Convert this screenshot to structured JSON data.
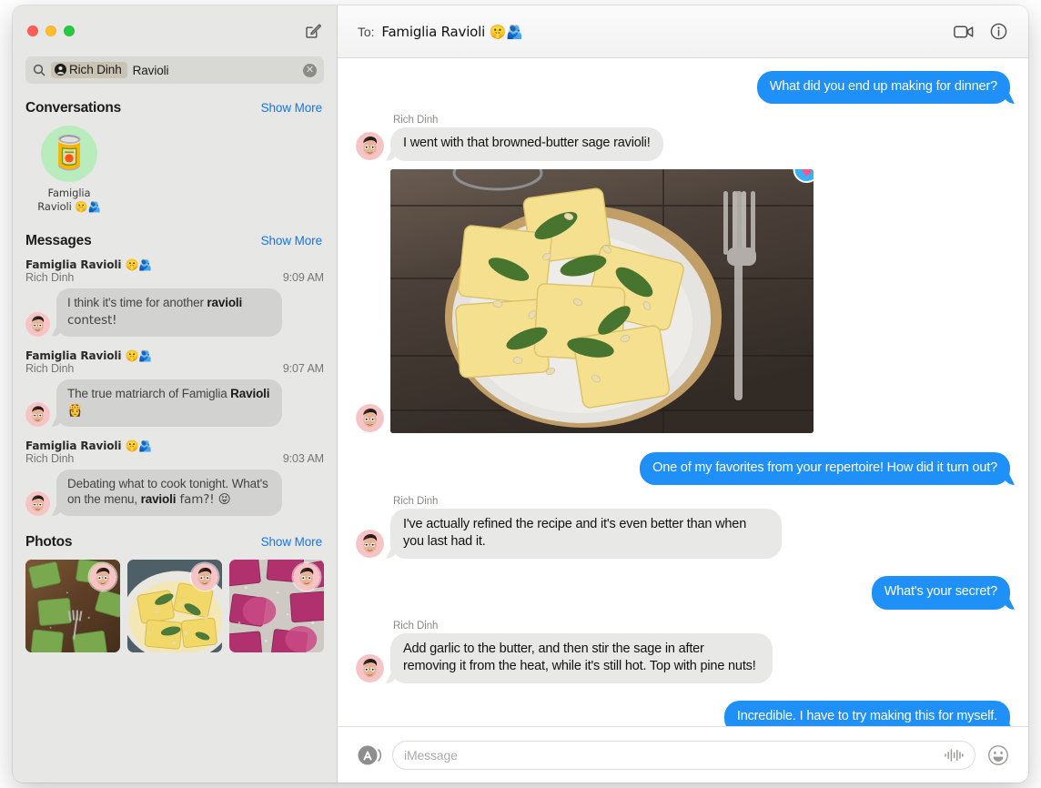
{
  "window": {
    "traffic_lights": [
      "close",
      "minimize",
      "zoom"
    ],
    "compose_icon": "compose-icon"
  },
  "search": {
    "icon": "search-icon",
    "token_icon": "person-circle-icon",
    "token_label": "Rich Dinh",
    "query_text": "Ravioli",
    "clear_icon": "clear-icon",
    "clear_glyph": "✕"
  },
  "sidebar": {
    "sections": {
      "conversations": {
        "title": "Conversations",
        "show_more": "Show More",
        "items": [
          {
            "avatar_emoji": "🥫",
            "avatar_bg": "#b8ecbd",
            "name_line1": "Famiglia",
            "name_line2": "Ravioli 🤫🫂"
          }
        ]
      },
      "messages": {
        "title": "Messages",
        "show_more": "Show More",
        "results": [
          {
            "chat": "Famiglia Ravioli 🤫🫂",
            "sender": "Rich Dinh",
            "time": "9:09 AM",
            "text_before": "I think it's time for another ",
            "match": "ravioli",
            "text_after": " contest!"
          },
          {
            "chat": "Famiglia Ravioli 🤫🫂",
            "sender": "Rich Dinh",
            "time": "9:07 AM",
            "text_before": "The true matriarch of Famiglia ",
            "match": "Ravioli",
            "text_after": " 👸"
          },
          {
            "chat": "Famiglia Ravioli 🤫🫂",
            "sender": "Rich Dinh",
            "time": "9:03 AM",
            "text_before": "Debating what to cook tonight. What's on the menu, ",
            "match": "ravioli",
            "text_after": " fam?! 😝"
          }
        ]
      },
      "photos": {
        "title": "Photos",
        "show_more": "Show More",
        "items": [
          {
            "description": "green-spinach-ravioli-on-wood"
          },
          {
            "description": "yellow-sage-ravioli-plate"
          },
          {
            "description": "pink-beet-ravioli-floured"
          }
        ]
      }
    }
  },
  "conversation": {
    "header": {
      "to_label": "To:",
      "recipient": "Famiglia Ravioli 🤫🫂",
      "facetime_icon": "video-camera-icon",
      "info_icon": "info-circle-icon"
    },
    "messages": [
      {
        "type": "text",
        "direction": "out",
        "text": "What did you end up making for dinner?"
      },
      {
        "type": "text",
        "direction": "in",
        "sender": "Rich Dinh",
        "text": "I went with that browned-butter sage ravioli!"
      },
      {
        "type": "image",
        "direction": "in",
        "description": "plate-of-sage-butter-ravioli-with-pine-nuts",
        "reaction": "heart"
      },
      {
        "type": "text",
        "direction": "out",
        "text": "One of my favorites from your repertoire! How did it turn out?"
      },
      {
        "type": "text",
        "direction": "in",
        "sender": "Rich Dinh",
        "text": "I've actually refined the recipe and it's even better than when you last had it."
      },
      {
        "type": "text",
        "direction": "out",
        "text": "What's your secret?"
      },
      {
        "type": "text",
        "direction": "in",
        "sender": "Rich Dinh",
        "text": "Add garlic to the butter, and then stir the sage in after removing it from the heat, while it's still hot. Top with pine nuts!"
      },
      {
        "type": "text",
        "direction": "out",
        "text": "Incredible. I have to try making this for myself."
      }
    ],
    "composer": {
      "apps_icon": "app-store-icon",
      "placeholder": "iMessage",
      "value": "",
      "audio_icon": "audio-waveform-icon",
      "emoji_icon": "emoji-smiley-icon"
    }
  },
  "colors": {
    "outgoing_bubble": "#1e90f7",
    "incoming_bubble": "#e8e8e7",
    "sidebar_bg": "#e7e7e5",
    "accent_link": "#1574f0",
    "tapback": "#3ab0f5",
    "heart": "#f5548c"
  }
}
